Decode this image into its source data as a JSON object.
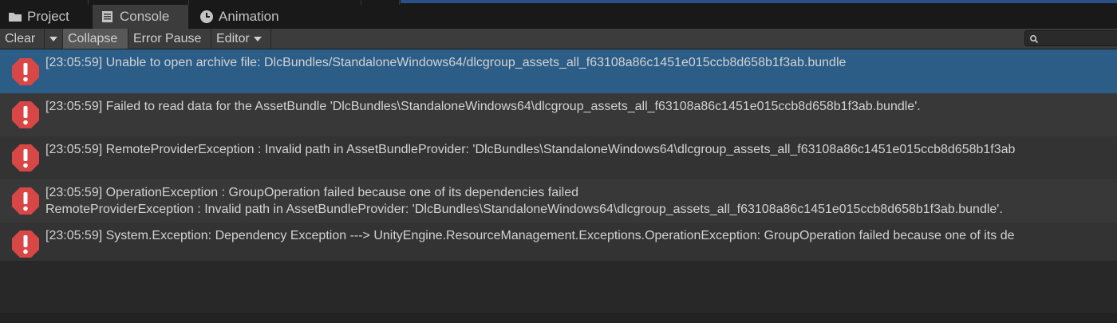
{
  "tabs": [
    {
      "label": "Project",
      "icon": "folder-icon"
    },
    {
      "label": "Console",
      "icon": "console-icon"
    },
    {
      "label": "Animation",
      "icon": "clock-icon"
    }
  ],
  "toolbar": {
    "clear_label": "Clear",
    "collapse_label": "Collapse",
    "error_pause_label": "Error Pause",
    "editor_label": "Editor",
    "search_placeholder": ""
  },
  "logs": [
    {
      "lines": [
        "[23:05:59] Unable to open archive file: DlcBundles/StandaloneWindows64/dlcgroup_assets_all_f63108a86c1451e015ccb8d658b1f3ab.bundle"
      ],
      "selected": true
    },
    {
      "lines": [
        "[23:05:59] Failed to read data for the AssetBundle 'DlcBundles\\StandaloneWindows64\\dlcgroup_assets_all_f63108a86c1451e015ccb8d658b1f3ab.bundle'."
      ],
      "selected": false
    },
    {
      "lines": [
        "[23:05:59] RemoteProviderException : Invalid path in AssetBundleProvider: 'DlcBundles\\StandaloneWindows64\\dlcgroup_assets_all_f63108a86c1451e015ccb8d658b1f3ab"
      ],
      "selected": false
    },
    {
      "lines": [
        "[23:05:59] OperationException : GroupOperation failed because one of its dependencies failed",
        "RemoteProviderException : Invalid path in AssetBundleProvider: 'DlcBundles\\StandaloneWindows64\\dlcgroup_assets_all_f63108a86c1451e015ccb8d658b1f3ab.bundle'."
      ],
      "selected": false
    },
    {
      "lines": [
        "[23:05:59] System.Exception: Dependency Exception ---> UnityEngine.ResourceManagement.Exceptions.OperationException: GroupOperation failed because one of its de"
      ],
      "selected": false
    }
  ],
  "colors": {
    "error_icon": "#d94646",
    "selected_row": "#2c5d87"
  }
}
